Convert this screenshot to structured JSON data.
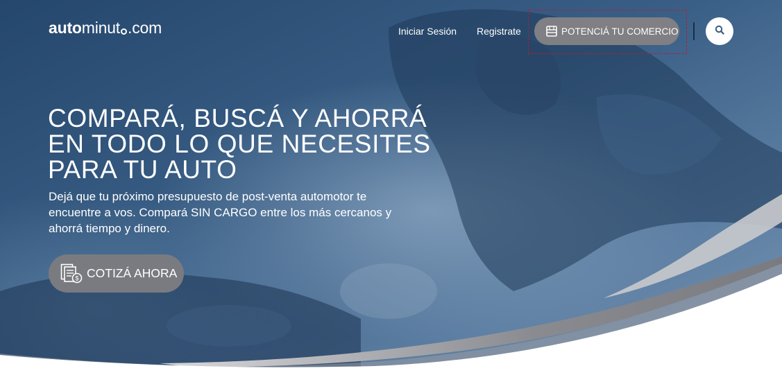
{
  "header": {
    "logo_bold": "auto",
    "logo_light_1": "minut",
    "logo_light_2": ".com",
    "nav": {
      "login": "Iniciar Sesión",
      "register": "Registrate"
    },
    "cta_commerce": "POTENCIÁ TU COMERCIO",
    "icons": {
      "store": "store-icon",
      "search": "search-icon"
    }
  },
  "hero": {
    "headline_lines": [
      "COMPARÁ, BUSCÁ Y AHORRÁ",
      "EN TODO LO QUE NECESITES",
      "PARA TU AUTO"
    ],
    "subtext": "Dejá que tu próximo presupuesto de post-venta automotor te encuentre a vos. Compará SIN CARGO entre los más cercanos y ahorrá tiempo y dinero.",
    "cta_quote": "COTIZÁ AHORA",
    "cta_icon": "quote-document-icon"
  },
  "colors": {
    "hero_overlay": "#2c4b6e",
    "wave_gray": "#8a8b90",
    "button_gray": "#7a7b80",
    "accent_dashed": "#b21d3a",
    "text": "#ffffff"
  }
}
